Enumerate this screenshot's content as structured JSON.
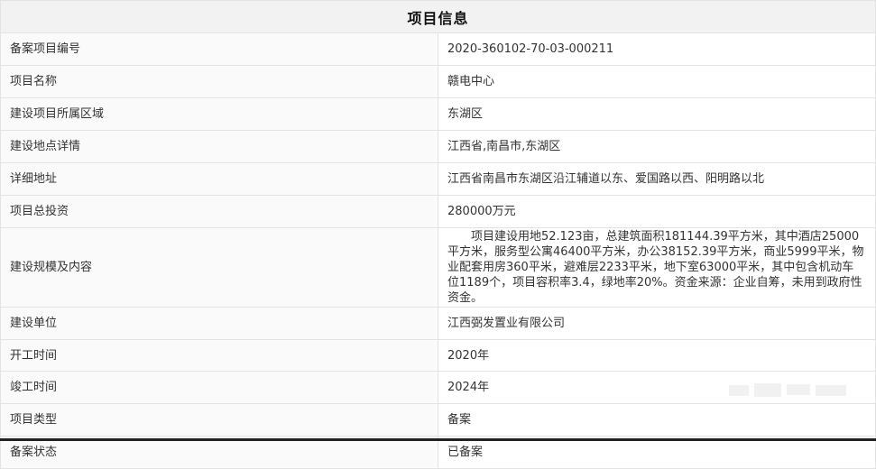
{
  "title": "项目信息",
  "rows": [
    {
      "label": "备案项目编号",
      "value": "2020-360102-70-03-000211"
    },
    {
      "label": "项目名称",
      "value": "赣电中心"
    },
    {
      "label": "建设项目所属区域",
      "value": "东湖区"
    },
    {
      "label": "建设地点详情",
      "value": "江西省,南昌市,东湖区"
    },
    {
      "label": "详细地址",
      "value": "江西省南昌市东湖区沿江辅道以东、爱国路以西、阳明路以北"
    },
    {
      "label": "项目总投资",
      "value": "280000万元"
    },
    {
      "label": "建设规模及内容",
      "value": "项目建设用地52.123亩，总建筑面积181144.39平方米，其中酒店25000平方米，服务型公寓46400平方米，办公38152.39平方米，商业5999平米，物业配套用房360平米，避难层2233平米，地下室63000平米，其中包含机动车位1189个，项目容积率3.4，绿地率20%。资金来源：企业自筹，未用到政府性资金。"
    },
    {
      "label": "建设单位",
      "value": "江西弼发置业有限公司"
    },
    {
      "label": "开工时间",
      "value": "2020年"
    },
    {
      "label": "竣工时间",
      "value": "2024年"
    },
    {
      "label": "项目类型",
      "value": "备案"
    },
    {
      "label": "备案状态",
      "value": "已备案"
    }
  ]
}
